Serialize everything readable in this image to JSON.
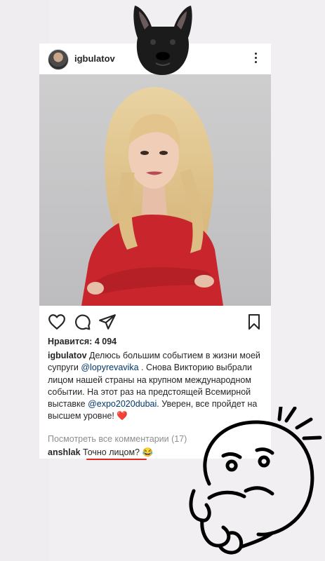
{
  "post": {
    "username": "igbulatov",
    "likes_label": "Нравится: 4 094",
    "caption": {
      "username": "igbulatov",
      "text_1": " Делюсь большим событием в жизни моей супруги ",
      "mention_1": "@lopyrevavika",
      "text_2": " .  Снова Викторию выбрали лицом нашей страны на крупном международном событии. На этот раз на предстоящей Всемирной выставке ",
      "mention_2": "@expo2020dubai",
      "text_3": ". Уверен, все пройдет на высшем уровне! ",
      "emoji": "❤️"
    },
    "view_comments_label": "Посмотреть все комментарии (17)",
    "comment": {
      "username": "anshlak",
      "text": " Точно лицом? ",
      "emoji": "😂"
    }
  },
  "icons": [
    "more-icon",
    "heart-icon",
    "comment-icon",
    "share-icon",
    "bookmark-icon"
  ],
  "colors": {
    "accent_underline": "#e2261d",
    "dress": "#c8262c",
    "mention": "#00376b"
  }
}
